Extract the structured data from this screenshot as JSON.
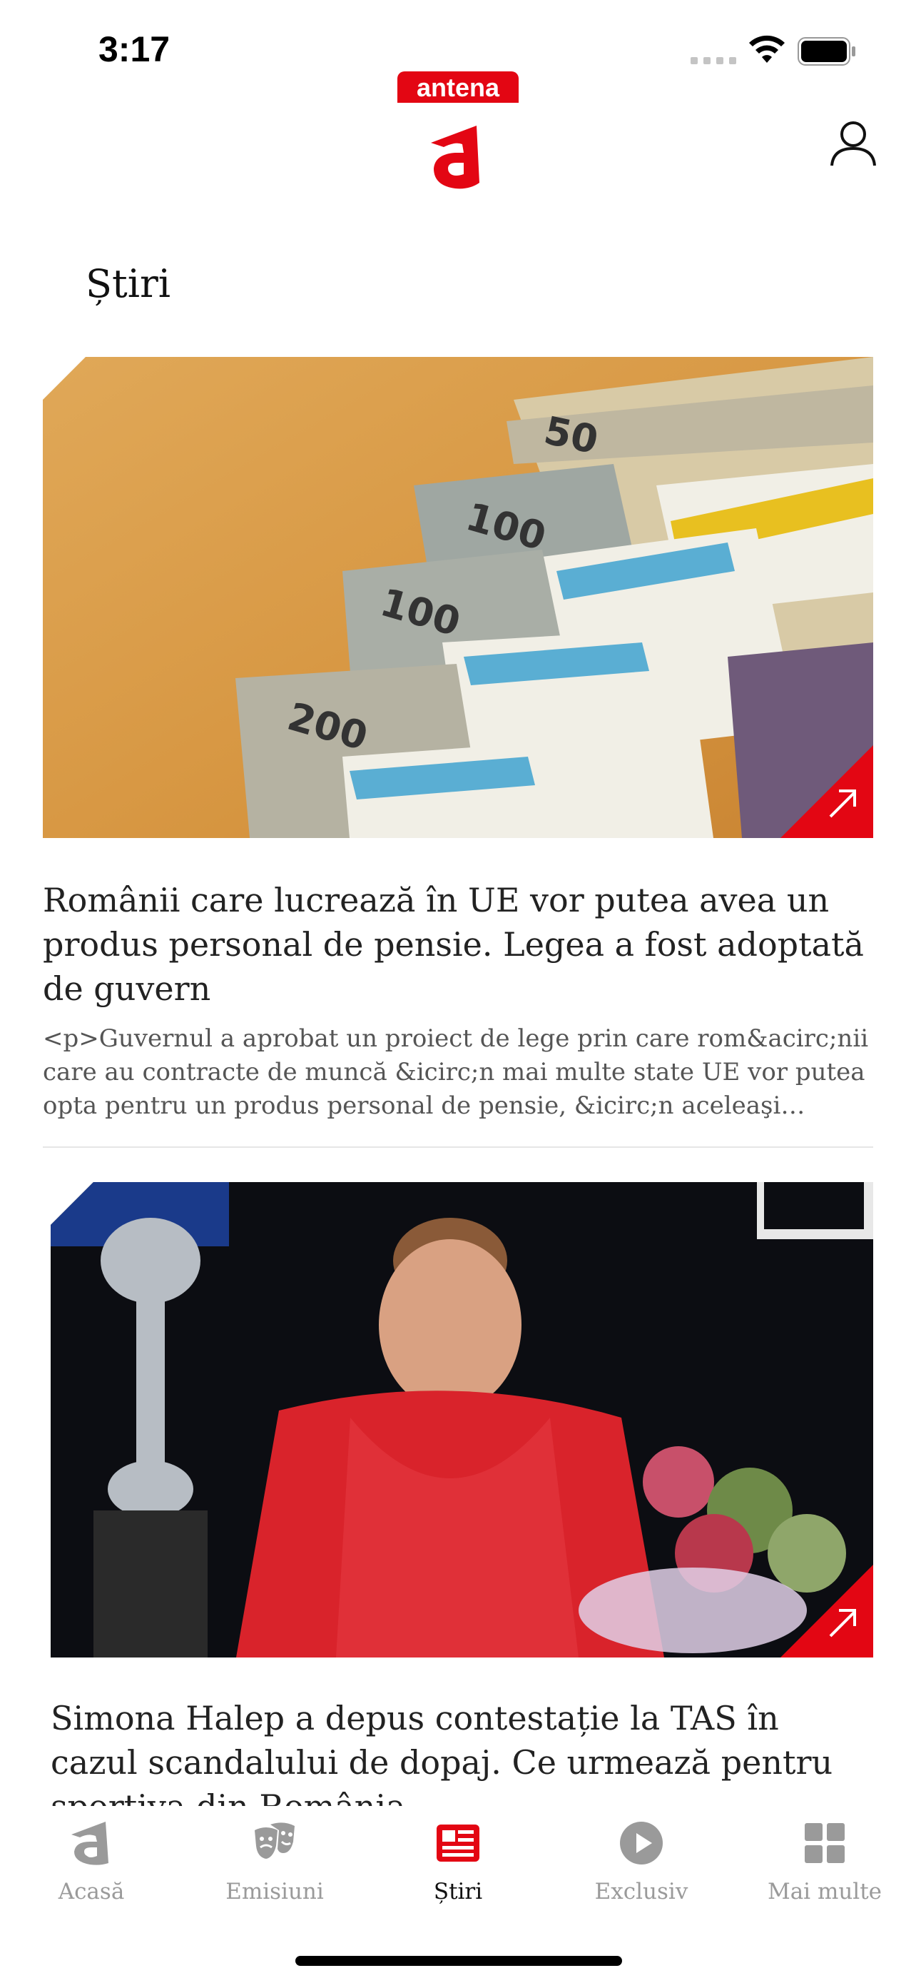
{
  "status_bar": {
    "time": "3:17"
  },
  "header": {
    "logo_text": "antena"
  },
  "section": {
    "title": "Știri"
  },
  "articles": [
    {
      "headline": "Românii care lucrează în UE vor putea avea un produs personal de pensie. Legea a fost adoptată de guvern",
      "excerpt": "<p>Guvernul a aprobat un proiect de lege prin care rom&acirc;nii care au contracte de muncă &icirc;n mai multe state UE vor putea opta pentru un produs personal de pensie, &icirc;n aceleaşi condiţii şi cu..."
    },
    {
      "headline": "Simona Halep a depus contestație la TAS în cazul scandalului de dopaj. Ce urmează pentru sportiva din România"
    }
  ],
  "tabs": [
    {
      "label": "Acasă",
      "icon": "home-a-icon"
    },
    {
      "label": "Emisiuni",
      "icon": "theater-masks-icon"
    },
    {
      "label": "Știri",
      "icon": "newspaper-icon",
      "active": true
    },
    {
      "label": "Exclusiv",
      "icon": "play-circle-icon"
    },
    {
      "label": "Mai multe",
      "icon": "grid-icon"
    }
  ],
  "colors": {
    "brand_red": "#e30613",
    "inactive_gray": "#9a9a9a"
  }
}
